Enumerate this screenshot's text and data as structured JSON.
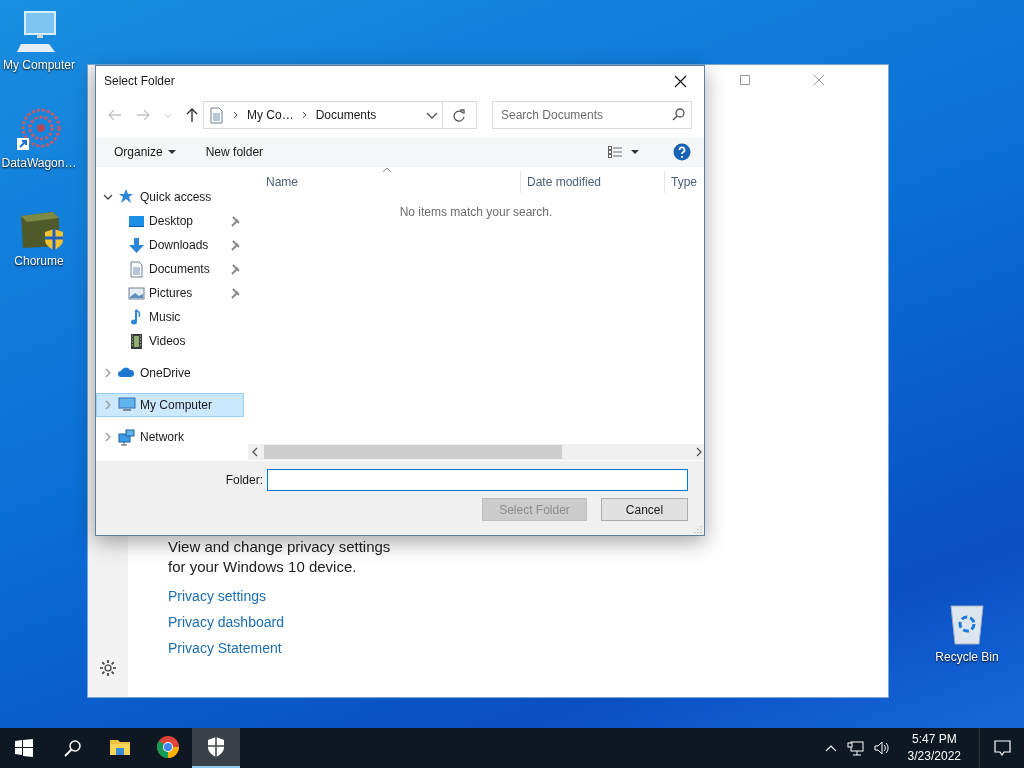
{
  "desktop_icons": [
    {
      "label": "My Computer",
      "kind": "computer"
    },
    {
      "label": "DataWagon…",
      "kind": "shortcut"
    },
    {
      "label": "Chorume",
      "kind": "installer"
    },
    {
      "label": "Recycle Bin",
      "kind": "bin"
    }
  ],
  "background_window": {
    "description": "View and change privacy settings for your Windows 10 device.",
    "links": [
      "Privacy settings",
      "Privacy dashboard",
      "Privacy Statement"
    ]
  },
  "dialog": {
    "title": "Select Folder",
    "breadcrumb": [
      "My Co…",
      "Documents"
    ],
    "search": {
      "placeholder": "Search Documents"
    },
    "toolbar": [
      "Organize",
      "New folder"
    ],
    "columns": [
      "Name",
      "Date modified",
      "Type"
    ],
    "empty_message": "No items match your search.",
    "nav": [
      {
        "label": "Quick access",
        "kind": "star",
        "expanded": true,
        "selected": false,
        "children": [
          {
            "label": "Desktop",
            "kind": "desktop",
            "pinned": true,
            "selected": false
          },
          {
            "label": "Downloads",
            "kind": "download",
            "pinned": true,
            "selected": false
          },
          {
            "label": "Documents",
            "kind": "document",
            "pinned": true,
            "selected": false
          },
          {
            "label": "Pictures",
            "kind": "picture",
            "pinned": true,
            "selected": false
          },
          {
            "label": "Music",
            "kind": "music",
            "pinned": false,
            "selected": false
          },
          {
            "label": "Videos",
            "kind": "video",
            "pinned": false,
            "selected": false
          }
        ]
      },
      {
        "label": "OneDrive",
        "kind": "cloud",
        "expanded": false,
        "selected": false
      },
      {
        "label": "My Computer",
        "kind": "computer",
        "expanded": false,
        "selected": true
      },
      {
        "label": "Network",
        "kind": "network",
        "expanded": false,
        "selected": false
      }
    ],
    "folder_label": "Folder:",
    "buttons": [
      {
        "label": "Select Folder",
        "disabled": true
      },
      {
        "label": "Cancel",
        "disabled": false
      }
    ]
  },
  "taskbar": {
    "apps": [
      {
        "kind": "explorer",
        "active": false
      },
      {
        "kind": "chrome",
        "active": false
      },
      {
        "kind": "shield",
        "active": true
      }
    ],
    "time": "5:47 PM",
    "date": "3/23/2022"
  }
}
